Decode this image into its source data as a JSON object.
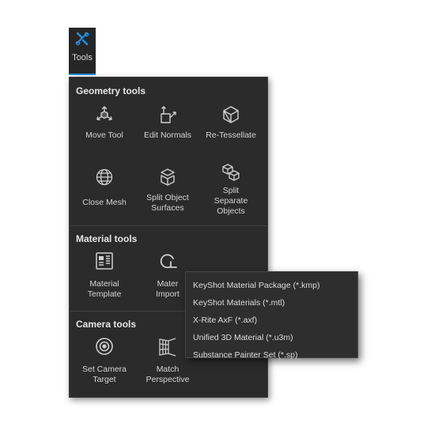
{
  "tab": {
    "label": "Tools",
    "icon": "tools-icon"
  },
  "geometry": {
    "title": "Geometry tools",
    "items": [
      {
        "label": "Move Tool",
        "icon": "move-tool-icon"
      },
      {
        "label": "Edit Normals",
        "icon": "edit-normals-icon"
      },
      {
        "label": "Re-Tessellate",
        "icon": "re-tessellate-icon"
      },
      {
        "label": "Close Mesh",
        "icon": "close-mesh-icon"
      },
      {
        "label": "Split Object\nSurfaces",
        "icon": "split-surfaces-icon"
      },
      {
        "label": "Split\nSeparate\nObjects",
        "icon": "split-objects-icon"
      }
    ]
  },
  "material": {
    "title": "Material tools",
    "items": [
      {
        "label": "Material\nTemplate",
        "icon": "material-template-icon"
      },
      {
        "label": "Mater\nImport",
        "icon": "material-import-icon"
      }
    ]
  },
  "camera": {
    "title": "Camera tools",
    "items": [
      {
        "label": "Set Camera\nTarget",
        "icon": "camera-target-icon"
      },
      {
        "label": "Match\nPerspective",
        "icon": "match-perspective-icon"
      }
    ]
  },
  "import_menu": {
    "items": [
      "KeyShot Material Package (*.kmp)",
      "KeyShot Materials (*.mtl)",
      "X-Rite AxF (*.axf)",
      "Unified 3D Material (*.u3m)",
      "Substance Painter Set (*.sp)"
    ]
  },
  "colors": {
    "panel_bg": "#2b2b2b",
    "accent": "#1e8fe1",
    "text": "#d4d4d4"
  }
}
